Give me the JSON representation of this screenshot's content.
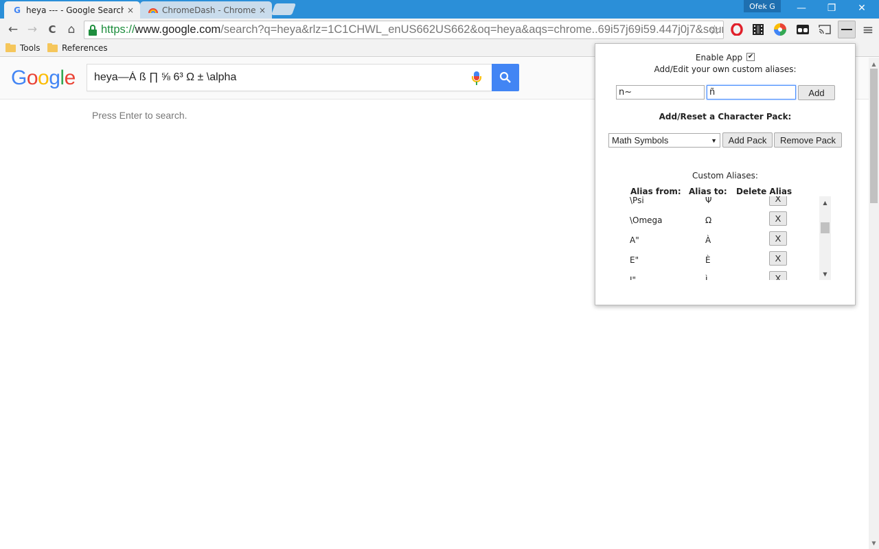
{
  "browser": {
    "tabs": [
      {
        "title": "heya --- - Google Search",
        "favicon": "google-g-icon",
        "close": "×"
      },
      {
        "title": "ChromeDash - Chrome We",
        "favicon": "chrome-rainbow-icon",
        "close": "×"
      }
    ],
    "profile_name": "Ofek G",
    "window_controls": {
      "minimize": "—",
      "restore": "❐",
      "close": "✕"
    },
    "nav": {
      "back": "←",
      "forward": "→",
      "reload": "C",
      "home": "⌂"
    },
    "address": {
      "scheme": "https://",
      "host": "www.google.com",
      "path": "/search?q=heya&rlz=1C1CHWL_enUS662US662&oq=heya&aqs=chrome..69i57j69i59.447j0j7&sourceid"
    },
    "star": "☆",
    "extensions": [
      "opera-icon",
      "film-icon",
      "color-wheel-icon",
      "glasses-icon",
      "cast-icon",
      "alias-extension-icon"
    ],
    "menu": "≡"
  },
  "bookmarks": [
    "Tools",
    "References"
  ],
  "google": {
    "logo_letters": [
      {
        "ch": "G",
        "color": "#4285f4"
      },
      {
        "ch": "o",
        "color": "#ea4335"
      },
      {
        "ch": "o",
        "color": "#fbbc05"
      },
      {
        "ch": "g",
        "color": "#4285f4"
      },
      {
        "ch": "l",
        "color": "#34a853"
      },
      {
        "ch": "e",
        "color": "#ea4335"
      }
    ],
    "query": "heya—Á ß ∏ ⅝ 6³ Ω ± \\alpha",
    "hint": "Press Enter to search."
  },
  "popup": {
    "enable_label": "Enable App",
    "enable_checked": true,
    "enable_mark": "✔",
    "subtitle": "Add/Edit your own custom aliases:",
    "alias_from_value": "n~",
    "alias_to_value": "ñ",
    "add_label": "Add",
    "pack_title": "Add/Reset a Character Pack:",
    "pack_selected": "Math Symbols",
    "add_pack_label": "Add Pack",
    "remove_pack_label": "Remove Pack",
    "custom_aliases_title": "Custom Aliases:",
    "columns": {
      "from": "Alias from:",
      "to": "Alias to:",
      "delete": "Delete Alias"
    },
    "aliases": [
      {
        "from": "\\Psi",
        "to": "Ψ",
        "delete": "X"
      },
      {
        "from": "\\Omega",
        "to": "Ω",
        "delete": "X"
      },
      {
        "from": "A\"",
        "to": "À",
        "delete": "X"
      },
      {
        "from": "E\"",
        "to": "È",
        "delete": "X"
      },
      {
        "from": "I\"",
        "to": "Ì",
        "delete": "X"
      }
    ]
  }
}
